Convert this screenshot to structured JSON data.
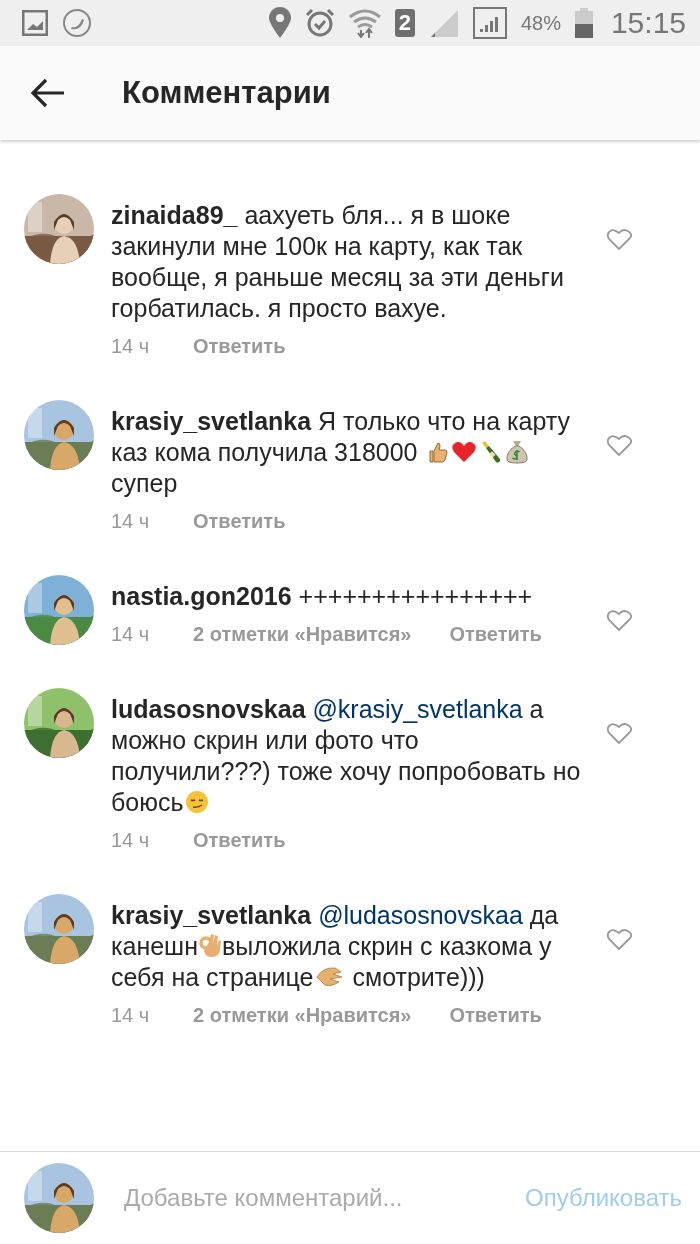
{
  "status_bar": {
    "sim": "2",
    "battery": "48%",
    "time": "15:15"
  },
  "header": {
    "title": "Комментарии"
  },
  "comments": [
    {
      "author": "zinaida89_",
      "parts": [
        {
          "kind": "text",
          "text": "аахуеть бля... я в шоке закинули мне 100к на карту, как так вообще, я раньше месяц за эти деньги горбатилась. я просто вахуе."
        }
      ],
      "time": "14 ч",
      "reply": "Ответить",
      "liked": false
    },
    {
      "author": "krasiy_svetlanka",
      "parts": [
        {
          "kind": "text",
          "text": "Я только что на карту каз кома получила 318000 "
        },
        {
          "kind": "thumb"
        },
        {
          "kind": "heart"
        },
        {
          "kind": "bottle"
        },
        {
          "kind": "moneybag"
        },
        {
          "kind": "text",
          "text": " супер"
        }
      ],
      "time": "14 ч",
      "reply": "Ответить",
      "liked": false
    },
    {
      "author": "nastia.gon2016",
      "parts": [
        {
          "kind": "text",
          "text": "++++++++++++++++"
        }
      ],
      "time": "14 ч",
      "likes": "2 отметки «Нравится»",
      "reply": "Ответить",
      "liked": false
    },
    {
      "author": "ludasosnovskaa",
      "parts": [
        {
          "kind": "mention",
          "text": "@krasiy_svetlanka"
        },
        {
          "kind": "text",
          "text": " а можно скрин или фото что получили???) тоже хочу попробовать но боюсь"
        },
        {
          "kind": "smirk"
        }
      ],
      "time": "14 ч",
      "reply": "Ответить",
      "liked": false
    },
    {
      "author": "krasiy_svetlanka",
      "parts": [
        {
          "kind": "mention",
          "text": "@ludasosnovskaa"
        },
        {
          "kind": "text",
          "text": " да канешн"
        },
        {
          "kind": "ok"
        },
        {
          "kind": "text",
          "text": "выложила скрин с казкома у себя на странице"
        },
        {
          "kind": "clap"
        },
        {
          "kind": "text",
          "text": " смотрите)))"
        }
      ],
      "time": "14 ч",
      "likes": "2 отметки «Нравится»",
      "reply": "Ответить",
      "liked": false
    }
  ],
  "composer": {
    "placeholder": "Добавьте комментарий...",
    "button": "Опубликовать",
    "disabled": true
  }
}
